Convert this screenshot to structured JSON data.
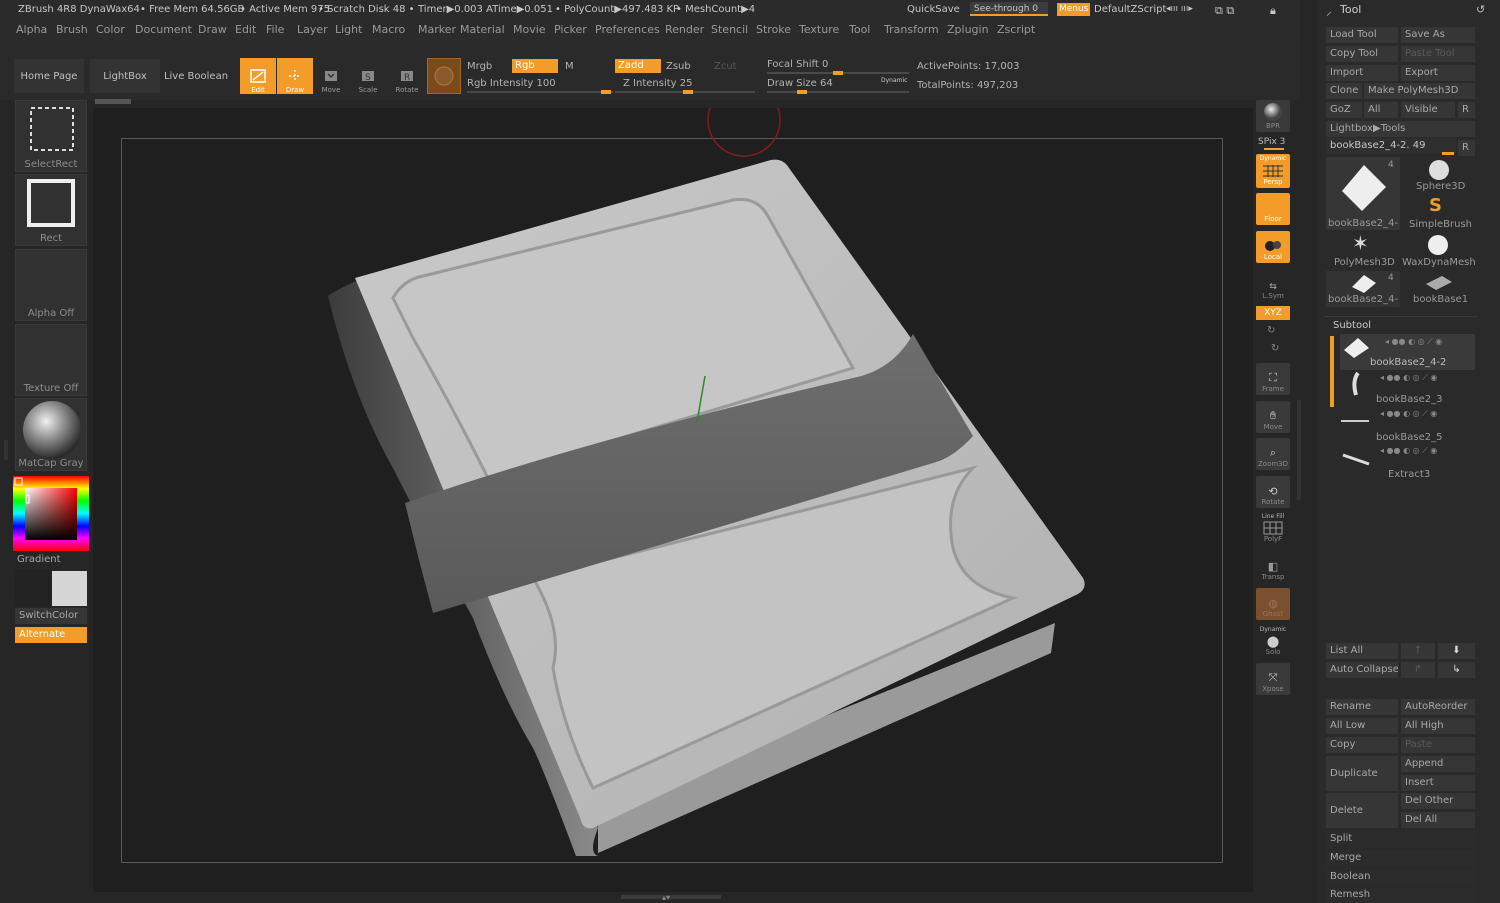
{
  "titlebar": {
    "app": "ZBrush 4R8 DynaWax64",
    "free_mem": "• Free Mem 64.56GB",
    "active_mem": "• Active Mem 975",
    "scratch": "• Scratch Disk 48 •",
    "timer": "Timer▶0.003 ATime▶0.051",
    "polycount": "• PolyCount▶497.483 KP",
    "meshcount": "• MeshCount▶4",
    "quicksave": "QuickSave",
    "see_through": "See-through   0",
    "menus": "Menus",
    "default_zscript": "DefaultZScript"
  },
  "menubar": [
    "Alpha",
    "Brush",
    "Color",
    "Document",
    "Draw",
    "Edit",
    "File",
    "Layer",
    "Light",
    "Macro",
    "Marker",
    "Material",
    "Movie",
    "Picker",
    "Preferences",
    "Render",
    "Stencil",
    "Stroke",
    "Texture",
    "Tool",
    "Transform",
    "Zplugin",
    "Zscript"
  ],
  "toolbar": {
    "home_page": "Home Page",
    "lightbox": "LightBox",
    "live_boolean": "Live Boolean",
    "edit": "Edit",
    "draw": "Draw",
    "move": "Move",
    "scale": "Scale",
    "rotate": "Rotate",
    "mrgb": "Mrgb",
    "rgb": "Rgb",
    "m": "M",
    "rgb_intensity": "Rgb Intensity 100",
    "zadd": "Zadd",
    "zsub": "Zsub",
    "zcut": "Zcut",
    "z_intensity": "Z Intensity 25",
    "focal_shift": "Focal Shift 0",
    "draw_size": "Draw Size 64",
    "dynamic": "Dynamic",
    "active_points": "ActivePoints: 17,003",
    "total_points": "TotalPoints: 497,203"
  },
  "left": {
    "select_rect": "SelectRect",
    "rect": "Rect",
    "alpha_off": "Alpha Off",
    "texture_off": "Texture Off",
    "matcap": "MatCap Gray",
    "gradient": "Gradient",
    "switch_color": "SwitchColor",
    "alternate": "Alternate"
  },
  "shelf": {
    "bpr": "BPR",
    "spix": "SPix 3",
    "dynamic": "Dynamic",
    "persp": "Persp",
    "floor": "Floor",
    "local": "Local",
    "lsym": "L.Sym",
    "xyz": "XYZ",
    "frame": "Frame",
    "move": "Move",
    "zoom3d": "Zoom3D",
    "rotate": "Rotate",
    "line_fill": "Line Fill",
    "polyf": "PolyF",
    "transp": "Transp",
    "ghost": "Ghost",
    "solo": "Solo",
    "xpose": "Xpose"
  },
  "panel": {
    "title": "Tool",
    "load_tool": "Load Tool",
    "save_as": "Save As",
    "copy_tool": "Copy Tool",
    "paste_tool": "Paste Tool",
    "import": "Import",
    "export": "Export",
    "clone": "Clone",
    "make_polymesh": "Make PolyMesh3D",
    "goz": "GoZ",
    "all": "All",
    "visible": "Visible",
    "r": "R",
    "lightbox_tools": "Lightbox▶Tools",
    "current_tool": "bookBase2_4-2. 49",
    "thumbs": [
      {
        "label": "bookBase2_4-",
        "count": "4"
      },
      {
        "label": "Sphere3D"
      },
      {
        "label": "SimpleBrush"
      },
      {
        "label": "PolyMesh3D"
      },
      {
        "label": "WaxDynaMesh"
      },
      {
        "label": "bookBase2_4-",
        "count": "4"
      },
      {
        "label": "bookBase1"
      }
    ],
    "subtool": "Subtool",
    "subtools": [
      "bookBase2_4-2",
      "bookBase2_3",
      "bookBase2_5",
      "Extract3"
    ],
    "list_all": "List All",
    "auto_collapse": "Auto Collapse",
    "rename": "Rename",
    "auto_reorder": "AutoReorder",
    "all_low": "All Low",
    "all_high": "All High",
    "copy": "Copy",
    "paste": "Paste",
    "append": "Append",
    "duplicate": "Duplicate",
    "insert": "Insert",
    "del_other": "Del Other",
    "delete": "Delete",
    "del_all": "Del All",
    "split": "Split",
    "merge": "Merge",
    "boolean": "Boolean",
    "remesh": "Remesh"
  },
  "colors": {
    "accent": "#f39c2a",
    "background": "#262626",
    "canvas": "#1f1f1f"
  }
}
